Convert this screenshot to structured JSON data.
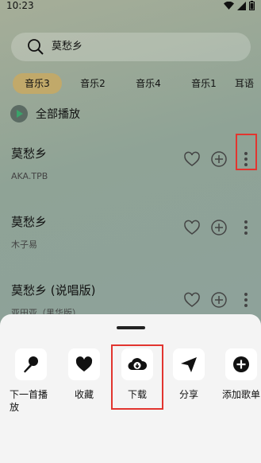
{
  "status_bar": {
    "time": "10:23"
  },
  "search": {
    "query": "莫愁乡"
  },
  "tabs": [
    {
      "label": "音乐3",
      "active": true
    },
    {
      "label": "音乐2",
      "active": false
    },
    {
      "label": "音乐4",
      "active": false
    },
    {
      "label": "音乐1",
      "active": false
    },
    {
      "label": "耳语",
      "active": false
    }
  ],
  "play_all": {
    "label": "全部播放"
  },
  "songs": [
    {
      "title": "莫愁乡",
      "artist": "AKA.TPB"
    },
    {
      "title": "莫愁乡",
      "artist": "木子易"
    },
    {
      "title": "莫愁乡 (说唱版)",
      "artist": "亚田亚（黑华版）"
    }
  ],
  "sheet_actions": [
    {
      "label": "下一首播放",
      "icon": "microphone-icon"
    },
    {
      "label": "收藏",
      "icon": "heart-icon"
    },
    {
      "label": "下载",
      "icon": "cloud-download-icon"
    },
    {
      "label": "分享",
      "icon": "send-icon"
    },
    {
      "label": "添加歌单",
      "icon": "plus-circle-icon"
    }
  ],
  "colors": {
    "accent_tab": "#c1a96a",
    "highlight": "#e2352f",
    "sheet_bg": "#f4f4f4"
  }
}
